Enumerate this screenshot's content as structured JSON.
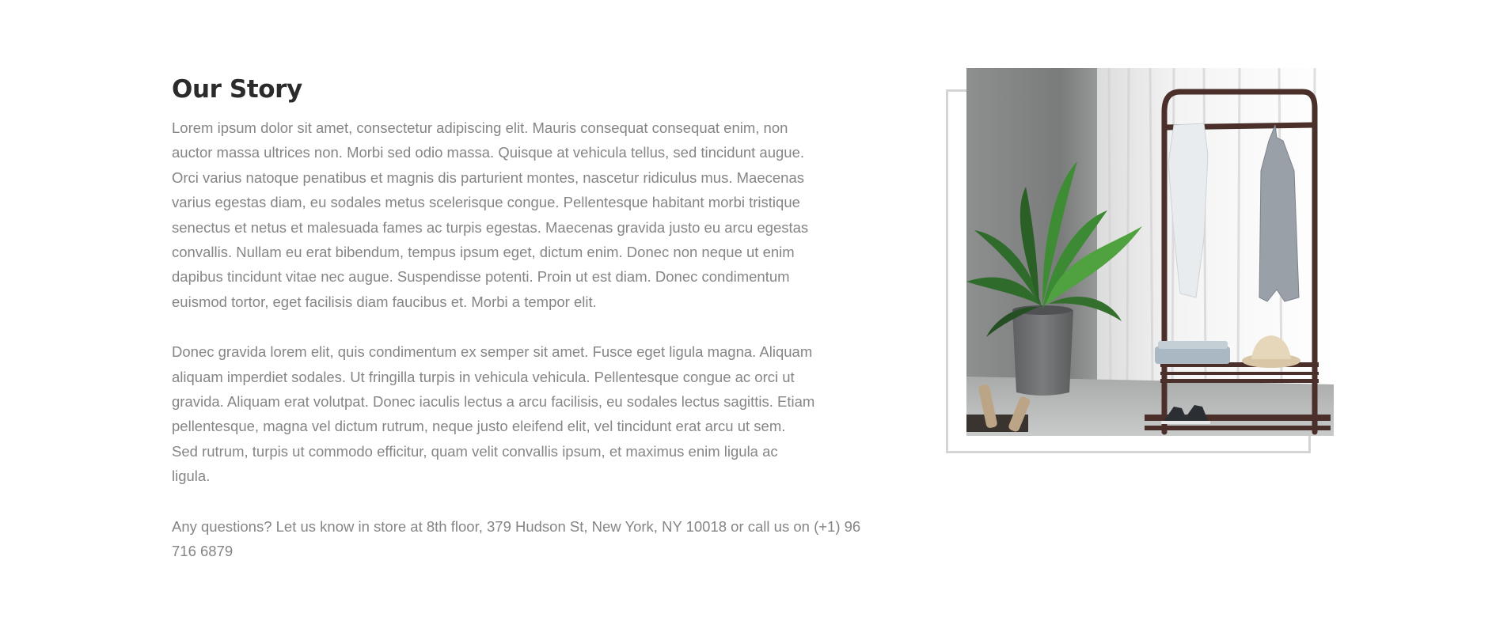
{
  "story": {
    "title": "Our Story",
    "paragraphs": [
      "Lorem ipsum dolor sit amet, consectetur adipiscing elit. Mauris consequat consequat enim, non\nauctor massa ultrices non. Morbi sed odio massa. Quisque at vehicula tellus, sed tincidunt augue.\nOrci varius natoque penatibus et magnis dis parturient montes, nascetur ridiculus mus. Maecenas\nvarius egestas diam, eu sodales metus scelerisque congue. Pellentesque habitant morbi tristique\nsenectus et netus et malesuada fames ac turpis egestas. Maecenas gravida justo eu arcu egestas\nconvallis. Nullam eu erat bibendum, tempus ipsum eget, dictum enim. Donec non neque ut enim\ndapibus tincidunt vitae nec augue. Suspendisse potenti. Proin ut est diam. Donec condimentum\neuismod tortor, eget facilisis diam faucibus et. Morbi a tempor elit.",
      "Donec gravida lorem elit, quis condimentum ex semper sit amet. Fusce eget ligula magna. Aliquam\naliquam imperdiet sodales. Ut fringilla turpis in vehicula vehicula. Pellentesque congue ac orci ut\ngravida. Aliquam erat volutpat. Donec iaculis lectus a arcu facilisis, eu sodales lectus sagittis. Etiam\npellentesque, magna vel dictum rutrum, neque justo eleifend elit, vel tincidunt erat arcu ut sem.\nSed rutrum, turpis ut commodo efficitur, quam velit convallis ipsum, et maximus enim ligula ac\nligula.",
      "Any questions? Let us know in store at 8th floor, 379 Hudson St, New York, NY 10018 or call us on (+1) 96\n716 6879"
    ]
  },
  "colors": {
    "heading": "#2b2b2b",
    "body_text": "#858585",
    "frame_border": "#d4d4d4",
    "background": "#ffffff"
  }
}
